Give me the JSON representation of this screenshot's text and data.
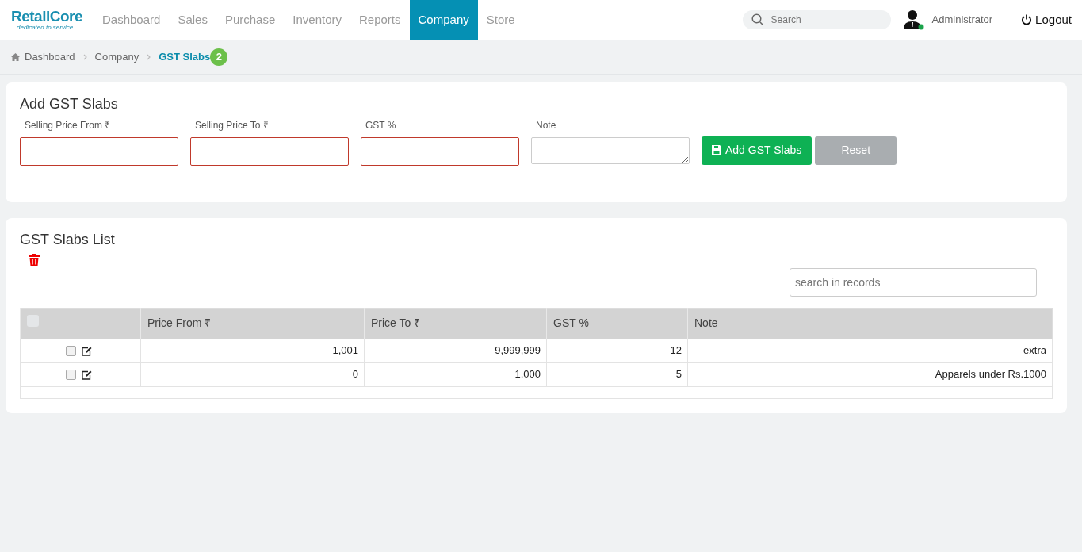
{
  "brand": {
    "name": "RetailCore",
    "tagline": "dedicated to service"
  },
  "nav": [
    {
      "label": "Dashboard",
      "selected": false
    },
    {
      "label": "Sales",
      "selected": false
    },
    {
      "label": "Purchase",
      "selected": false
    },
    {
      "label": "Inventory",
      "selected": false
    },
    {
      "label": "Reports",
      "selected": false
    },
    {
      "label": "Company",
      "selected": true
    },
    {
      "label": "Store",
      "selected": false
    }
  ],
  "search": {
    "placeholder": "Search"
  },
  "user": {
    "name": "Administrator",
    "online": true
  },
  "logout": "Logout",
  "breadcrumb": [
    {
      "label": "Dashboard",
      "current": false
    },
    {
      "label": "Company",
      "current": false
    },
    {
      "label": "GST Slabs",
      "current": true
    }
  ],
  "breadcrumb_badge": "2",
  "form": {
    "title": "Add GST Slabs",
    "fields": [
      {
        "label": "Selling Price From ₹",
        "kind": "input",
        "invalid": true
      },
      {
        "label": "Selling Price To ₹",
        "kind": "input",
        "invalid": true
      },
      {
        "label": "GST %",
        "kind": "input",
        "invalid": true
      },
      {
        "label": "Note",
        "kind": "textarea",
        "invalid": false
      }
    ],
    "buttons": [
      {
        "label": "Add GST Slabs",
        "kind": "primary"
      },
      {
        "label": "Reset",
        "kind": "secondary"
      }
    ]
  },
  "list": {
    "title": "GST Slabs List",
    "search": {
      "placeholder": "search in records"
    },
    "select_all": {
      "checked": false
    },
    "columns": [
      "Price From ₹",
      "Price To ₹",
      "GST %",
      "Note"
    ],
    "rows": [
      {
        "checked": false,
        "cells": [
          "1,001",
          "9,999,999",
          "12",
          "extra"
        ]
      },
      {
        "checked": false,
        "cells": [
          "0",
          "1,000",
          "5",
          "Apparels under Rs.1000"
        ]
      }
    ]
  }
}
